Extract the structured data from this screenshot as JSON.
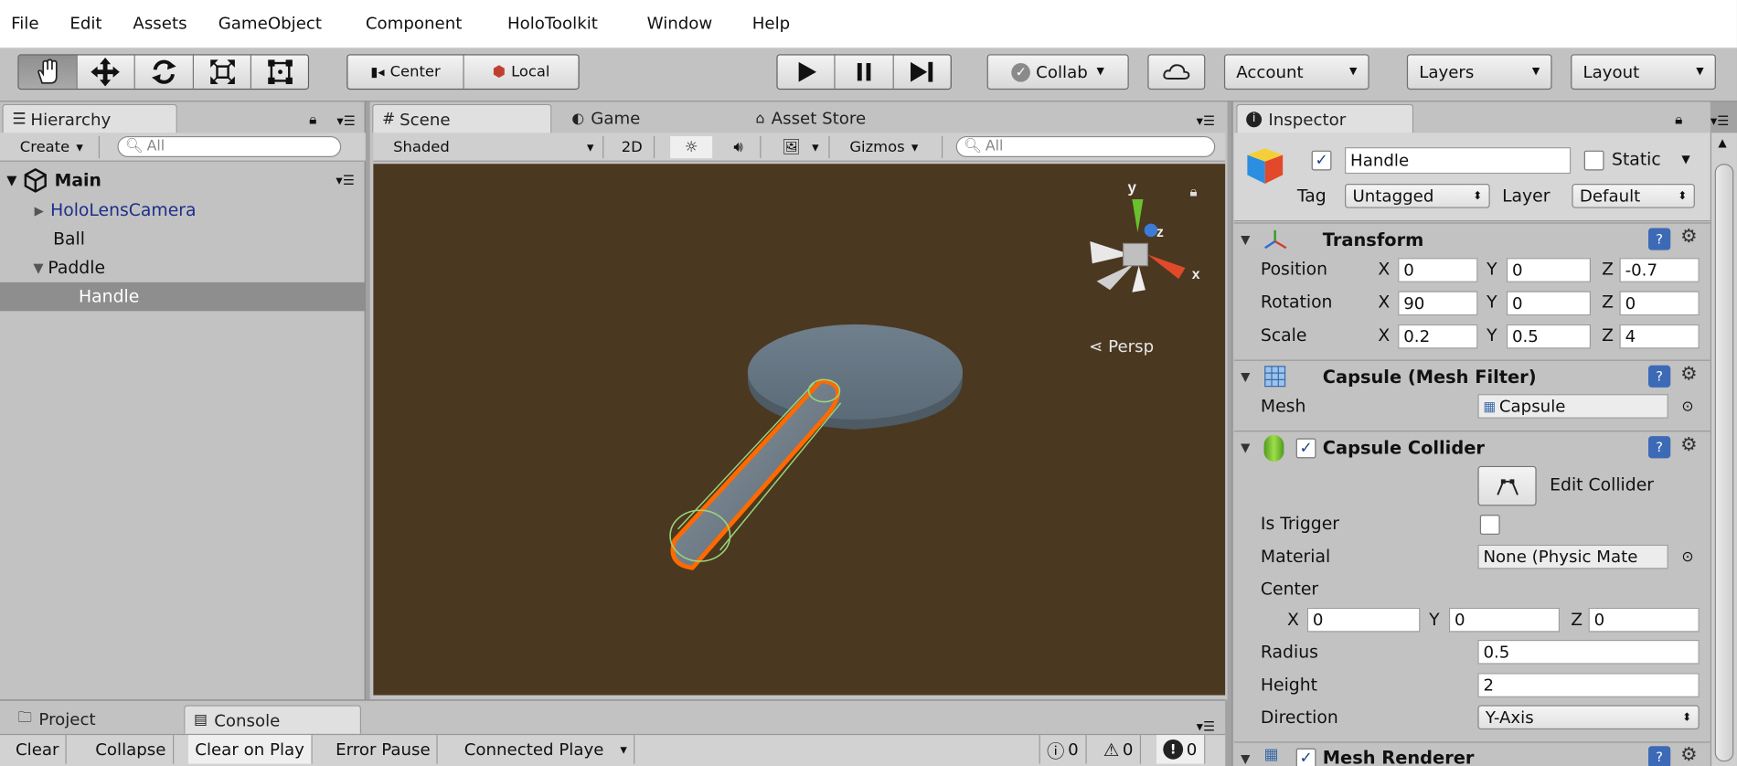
{
  "menu": [
    "File",
    "Edit",
    "Assets",
    "GameObject",
    "Component",
    "HoloToolkit",
    "Window",
    "Help"
  ],
  "toolbar": {
    "pivot": "Center",
    "space": "Local",
    "collab": "Collab",
    "account": "Account",
    "layers": "Layers",
    "layout": "Layout",
    "icons": [
      "hand-icon",
      "move-icon",
      "rotate-icon",
      "scale-icon",
      "rect-icon"
    ]
  },
  "hierarchy": {
    "tab": "Hierarchy",
    "create": "Create",
    "search_placeholder": "All",
    "scene": "Main",
    "items": [
      "HoloLensCamera",
      "Ball",
      "Paddle",
      "Handle"
    ]
  },
  "scene": {
    "tabs": [
      "Scene",
      "Game",
      "Asset Store"
    ],
    "shading": "Shaded",
    "mode2d": "2D",
    "gizmos": "Gizmos",
    "search_placeholder": "All",
    "persp": "Persp",
    "axis_x": "x",
    "axis_y": "y",
    "axis_z": "z"
  },
  "inspector": {
    "tab": "Inspector",
    "name": "Handle",
    "static": "Static",
    "tag_label": "Tag",
    "tag": "Untagged",
    "layer_label": "Layer",
    "layer": "Default",
    "transform": {
      "title": "Transform",
      "rows": [
        {
          "label": "Position",
          "x": "0",
          "y": "0",
          "z": "-0.7"
        },
        {
          "label": "Rotation",
          "x": "90",
          "y": "0",
          "z": "0"
        },
        {
          "label": "Scale",
          "x": "0.2",
          "y": "0.5",
          "z": "4"
        }
      ],
      "axis_x": "X",
      "axis_y": "Y",
      "axis_z": "Z"
    },
    "mesh_filter": {
      "title": "Capsule (Mesh Filter)",
      "mesh_label": "Mesh",
      "mesh": "Capsule"
    },
    "collider": {
      "title": "Capsule Collider",
      "edit": "Edit Collider",
      "is_trigger": "Is Trigger",
      "material_label": "Material",
      "material": "None (Physic Mate",
      "center_label": "Center",
      "cx": "0",
      "cy": "0",
      "cz": "0",
      "radius_label": "Radius",
      "radius": "0.5",
      "height_label": "Height",
      "height": "2",
      "direction_label": "Direction",
      "direction": "Y-Axis"
    },
    "mesh_renderer": "Mesh Renderer"
  },
  "console": {
    "tabs": [
      "Project",
      "Console"
    ],
    "buttons": [
      "Clear",
      "Collapse",
      "Clear on Play",
      "Error Pause",
      "Connected Playe"
    ],
    "info_count": "0",
    "warn_count": "0",
    "error_count": "0"
  }
}
